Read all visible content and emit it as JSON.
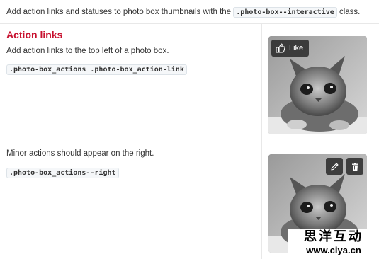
{
  "intro": {
    "text_before": "Add action links and statuses to photo box thumbnails with the ",
    "code": ".photo-box--interactive",
    "text_after": " class."
  },
  "section1": {
    "title": "Action links",
    "description": "Add action links to the top left of a photo box.",
    "code": ".photo-box_actions .photo-box_action-link",
    "photo": {
      "like_label": "Like",
      "like_icon": "thumbs-up-icon"
    }
  },
  "section2": {
    "description": "Minor actions should appear on the right.",
    "code": ".photo-box_actions--right",
    "photo": {
      "edit_icon": "pencil-icon",
      "delete_icon": "trash-icon"
    }
  },
  "watermark": {
    "chinese": "思洋互动",
    "url": "www.ciya.cn"
  },
  "colors": {
    "section_title": "#c8102e",
    "action_bg": "#282828",
    "code_bg": "#f5f7f9"
  }
}
